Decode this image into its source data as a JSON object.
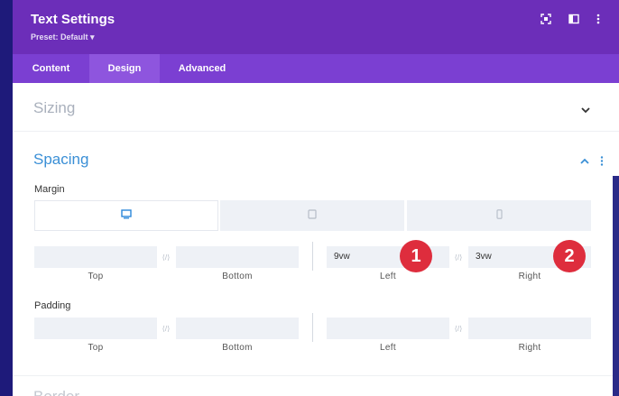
{
  "header": {
    "title": "Text Settings",
    "preset": "Preset: Default ▾"
  },
  "tabs": [
    {
      "label": "Content",
      "active": false
    },
    {
      "label": "Design",
      "active": true
    },
    {
      "label": "Advanced",
      "active": false
    }
  ],
  "sections": {
    "sizing": {
      "title": "Sizing",
      "expanded": false
    },
    "spacing": {
      "title": "Spacing",
      "expanded": true
    },
    "border": {
      "title": "Border"
    }
  },
  "spacing": {
    "margin": {
      "label": "Margin",
      "devices": [
        "desktop",
        "tablet",
        "phone"
      ],
      "active_device": "desktop",
      "fields": [
        {
          "label": "Top",
          "value": ""
        },
        {
          "label": "Bottom",
          "value": ""
        },
        {
          "label": "Left",
          "value": "9vw"
        },
        {
          "label": "Right",
          "value": "3vw"
        }
      ]
    },
    "padding": {
      "label": "Padding",
      "fields": [
        {
          "label": "Top",
          "value": ""
        },
        {
          "label": "Bottom",
          "value": ""
        },
        {
          "label": "Left",
          "value": ""
        },
        {
          "label": "Right",
          "value": ""
        }
      ]
    }
  },
  "annotations": [
    "1",
    "2"
  ],
  "colors": {
    "header": "#6c2eb9",
    "tabs": "#7b3fd2",
    "active_tab": "#8e55de",
    "spacing_title": "#3a8fd6",
    "badge": "#de2d3d"
  }
}
